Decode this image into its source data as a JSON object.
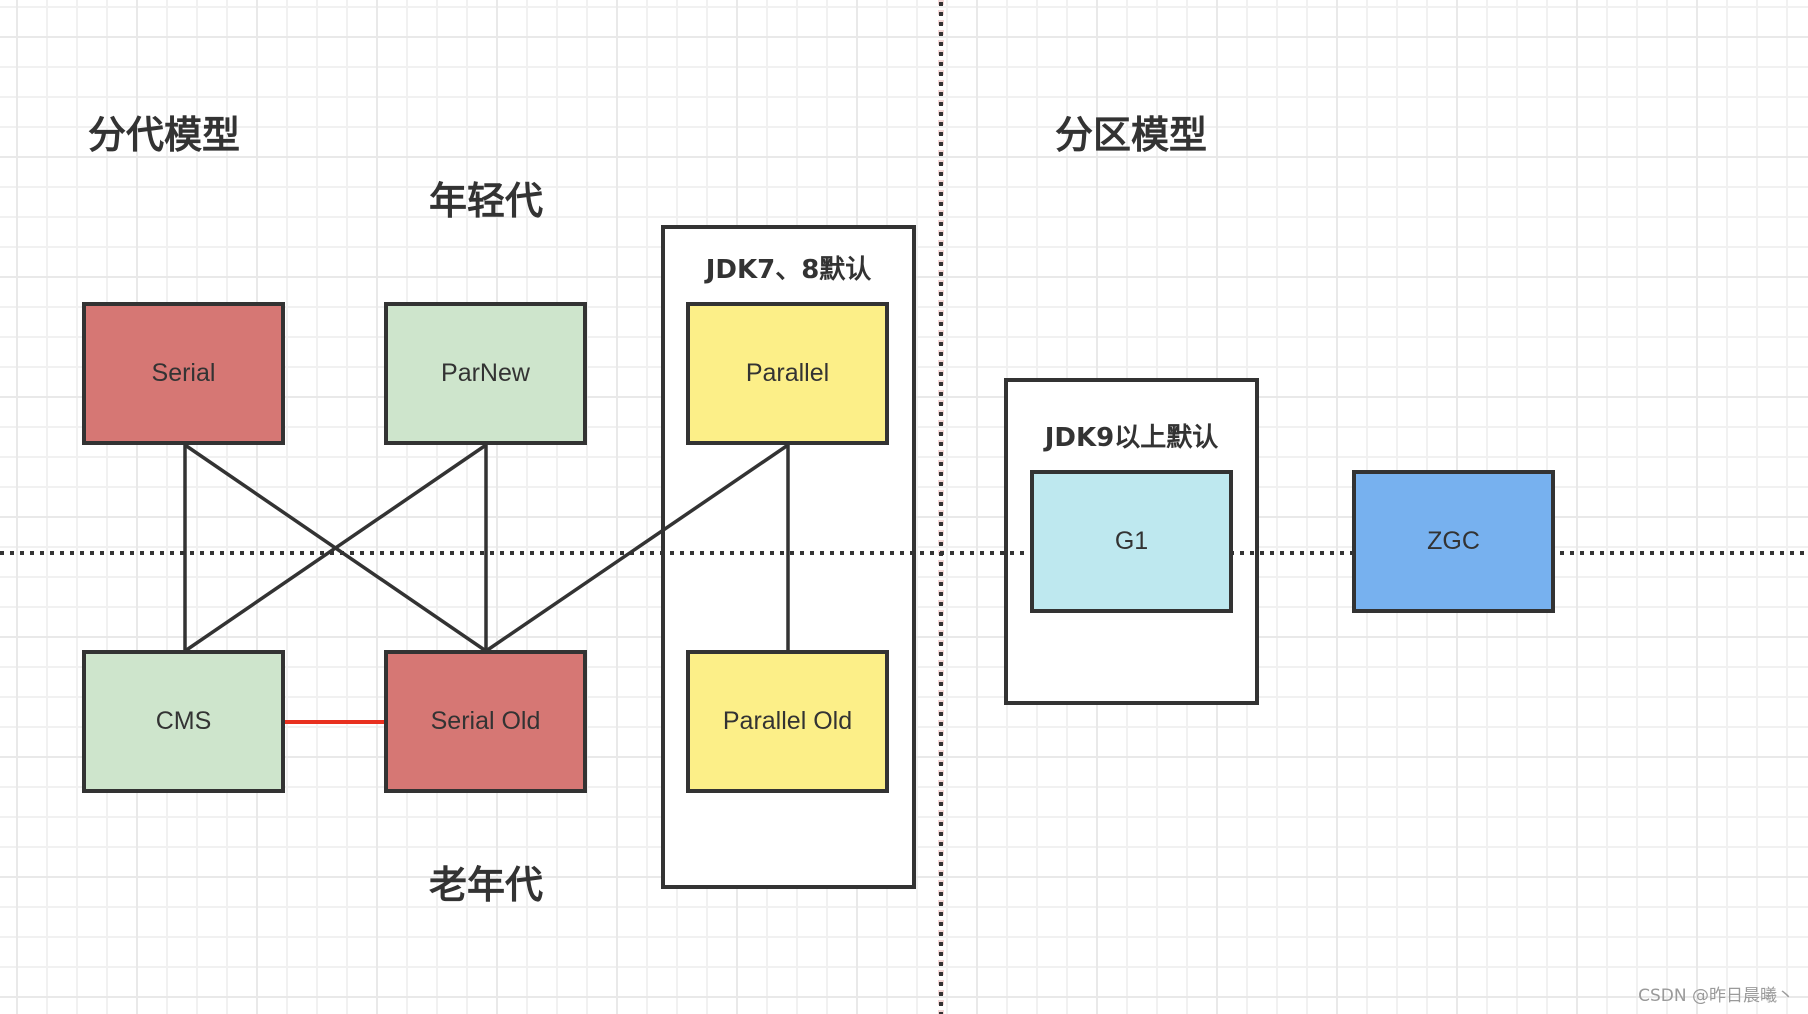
{
  "headings": {
    "generational_model": "分代模型",
    "region_model": "分区模型",
    "young_generation": "年轻代",
    "old_generation": "老年代"
  },
  "containers": {
    "jdk78_default": {
      "title": "JDK7、8默认"
    },
    "jdk9_default": {
      "title": "JDK9以上默认"
    }
  },
  "collectors": {
    "serial": {
      "label": "Serial",
      "generation": "young",
      "color": "#d67774"
    },
    "parnew": {
      "label": "ParNew",
      "generation": "young",
      "color": "#cee5cc"
    },
    "parallel": {
      "label": "Parallel",
      "generation": "young",
      "color": "#fcef88"
    },
    "cms": {
      "label": "CMS",
      "generation": "old",
      "color": "#cee5cc"
    },
    "serial_old": {
      "label": "Serial Old",
      "generation": "old",
      "color": "#d67774"
    },
    "parallel_old": {
      "label": "Parallel Old",
      "generation": "old",
      "color": "#fcef88"
    },
    "g1": {
      "label": "G1",
      "generation": "region",
      "color": "#bee8ef"
    },
    "zgc": {
      "label": "ZGC",
      "generation": "region",
      "color": "#77b1ef"
    }
  },
  "connections": [
    {
      "from": "Serial",
      "to": "CMS",
      "style": "solid",
      "color": "#333333"
    },
    {
      "from": "Serial",
      "to": "Serial Old",
      "style": "solid",
      "color": "#333333"
    },
    {
      "from": "ParNew",
      "to": "CMS",
      "style": "solid",
      "color": "#333333"
    },
    {
      "from": "ParNew",
      "to": "Serial Old",
      "style": "solid",
      "color": "#333333"
    },
    {
      "from": "Parallel",
      "to": "Serial Old",
      "style": "solid",
      "color": "#333333"
    },
    {
      "from": "Parallel",
      "to": "Parallel Old",
      "style": "solid",
      "color": "#333333"
    },
    {
      "from": "CMS",
      "to": "Serial Old",
      "style": "solid",
      "color": "#e8301f",
      "note": "fallback"
    }
  ],
  "dividers": {
    "generation_divider": {
      "style": "dotted",
      "color": "#333333"
    },
    "model_divider": {
      "style": "dotted",
      "color": "#333333"
    }
  },
  "watermark": "CSDN @昨日晨曦丶"
}
